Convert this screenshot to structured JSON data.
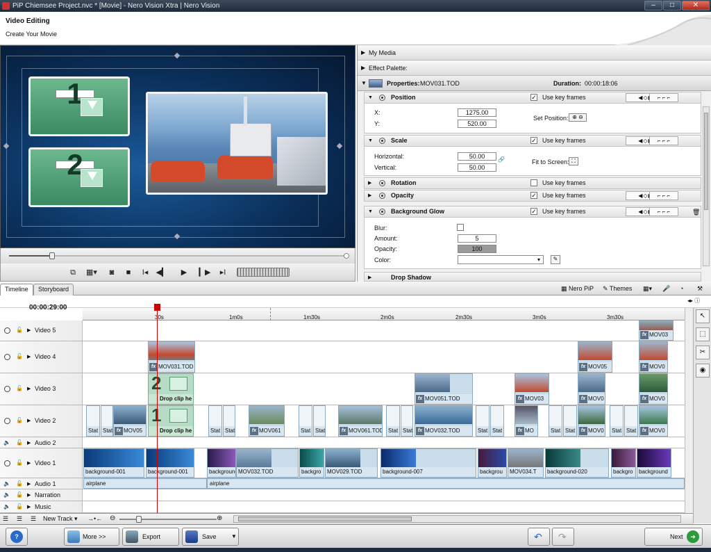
{
  "window": {
    "title": "PiP Chiemsee Project.nvc * [Movie] - Nero Vision Xtra | Nero Vision"
  },
  "header": {
    "title": "Video Editing",
    "subtitle": "Create Your Movie"
  },
  "preview": {
    "slot1": "1",
    "slot2": "2"
  },
  "panel": {
    "my_media": "My Media",
    "effect_palette": "Effect Palette:",
    "properties_label": "Properties:",
    "clip_name": "MOV031.TOD",
    "duration_label": "Duration:",
    "duration": "00:00:18:06",
    "use_key_frames": "Use key frames",
    "position": {
      "name": "Position",
      "x_label": "X:",
      "x": "1275.00",
      "y_label": "Y:",
      "y": "520.00",
      "set_position": "Set Position:"
    },
    "scale": {
      "name": "Scale",
      "h_label": "Horizontal:",
      "h": "50.00",
      "v_label": "Vertical:",
      "v": "50.00",
      "fit": "Fit to Screen:"
    },
    "rotation": {
      "name": "Rotation"
    },
    "opacity": {
      "name": "Opacity"
    },
    "glow": {
      "name": "Background Glow",
      "blur": "Blur:",
      "amount_label": "Amount:",
      "amount": "5",
      "opacity_label": "Opacity:",
      "opacity": "100",
      "color_label": "Color:"
    },
    "drop_shadow": "Drop Shadow"
  },
  "tabs": {
    "timeline": "Timeline",
    "storyboard": "Storyboard",
    "nero_pip": "Nero PiP",
    "themes": "Themes"
  },
  "timeline": {
    "timecode": "00:00:29:00",
    "ruler": [
      "30s",
      "1m0s",
      "1m30s",
      "2m0s",
      "2m30s",
      "3m0s",
      "3m30s"
    ],
    "tracks": {
      "video5": "Video 5",
      "video4": "Video 4",
      "video3": "Video 3",
      "video2": "Video 2",
      "audio2": "Audio 2",
      "video1": "Video 1",
      "audio1": "Audio 1",
      "narration": "Narration",
      "music": "Music"
    },
    "clips": {
      "v5a": "MOV03",
      "v4a": "MOV031.TOD",
      "v4b": "MOV05",
      "v4c": "MOV0",
      "v3drop": "Drop clip he",
      "v3a": "MOV051.TOD",
      "v3b": "MOV03",
      "v3c": "MOV0",
      "v3d": "MOV0",
      "v2drop": "Drop clip he",
      "stat": "Stat",
      "v2a": "MOV05",
      "v2b": "MOV061",
      "v2c": "MOV061.TOD",
      "v2d": "MOV032.TOD",
      "v2e": "MO",
      "v2f": "MOV0",
      "v2g": "MOV0",
      "v1a": "background-001",
      "v1b": "background-001",
      "v1c": "background",
      "v1d": "MOV032.TOD",
      "v1e": "backgro",
      "v1f": "MOV029.TOD",
      "v1g": "background-007",
      "v1h": "backgrou",
      "v1i": "MOV034.T",
      "v1j": "background-020",
      "v1k": "backgro",
      "v1l": "background",
      "a1a": "airplane",
      "a1b": "airplane"
    },
    "new_track": "New Track"
  },
  "footer": {
    "more": "More >>",
    "export": "Export",
    "save": "Save",
    "next": "Next"
  }
}
